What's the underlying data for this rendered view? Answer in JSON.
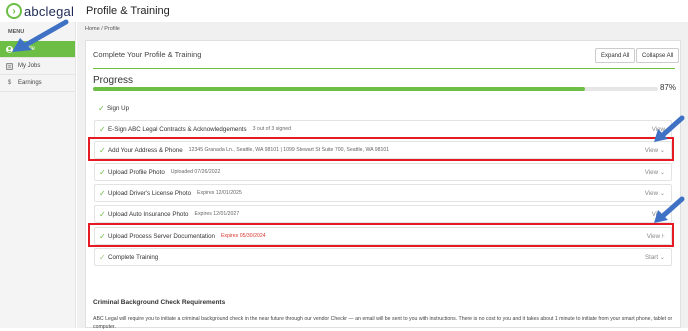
{
  "app": {
    "logo_text": "abclegal",
    "title": "Profile & Training"
  },
  "sidebar": {
    "menu_label": "MENU",
    "items": [
      {
        "label": "Profile",
        "icon": "user-icon",
        "active": true
      },
      {
        "label": "My Jobs",
        "icon": "jobs-icon",
        "active": false
      },
      {
        "label": "Earnings",
        "icon": "dollar-icon",
        "active": false
      }
    ]
  },
  "breadcrumb": "Home / Profile",
  "card": {
    "title": "Complete Your Profile & Training",
    "expand_all": "Expand All",
    "collapse_all": "Collapse All"
  },
  "progress": {
    "title": "Progress",
    "percent_label": "87%",
    "value": 0.87,
    "color": "#6dbe45"
  },
  "steps": [
    {
      "title": "Sign Up",
      "detail": "",
      "action": "",
      "boxed": false
    },
    {
      "title": "E-Sign ABC Legal Contracts & Acknowledgements",
      "detail": "3 out of 3 signed",
      "action": "View",
      "boxed": true
    },
    {
      "title": "Add Your Address & Phone",
      "detail": "12345 Granada Ln., Seattle, WA 98101 | 1099 Stewart St Suite 700, Seattle, WA 98101",
      "action": "View ⌄",
      "boxed": true
    },
    {
      "title": "Upload Profile Photo",
      "detail": "Uploaded 07/26/2022",
      "action": "View ⌄",
      "boxed": true
    },
    {
      "title": "Upload Driver's License Photo",
      "detail": "Expires 12/01/2025",
      "action": "View ⌄",
      "boxed": true
    },
    {
      "title": "Upload Auto Insurance Photo",
      "detail": "Expires 12/01/2027",
      "action": "View",
      "boxed": true
    },
    {
      "title": "Upload Process Server Documentation",
      "detail": "Expires 05/30/2024",
      "action": "View ⊦",
      "boxed": true
    },
    {
      "title": "Complete Training",
      "detail": "",
      "action": "Start ⌄",
      "boxed": true
    }
  ],
  "criminal": {
    "title": "Criminal Background Check Requirements",
    "text": "ABC Legal will require you to initiate a criminal background check in the near future through our vendor Checkr — an email will be sent to you with instructions. There is no cost to you and it takes about 1 minute to initiate from your smart phone, tablet or computer."
  },
  "colors": {
    "accent": "#6dbe45",
    "highlight": "#e51b24",
    "arrow": "#3f72c4",
    "expiry_warning": "#d9372c"
  }
}
